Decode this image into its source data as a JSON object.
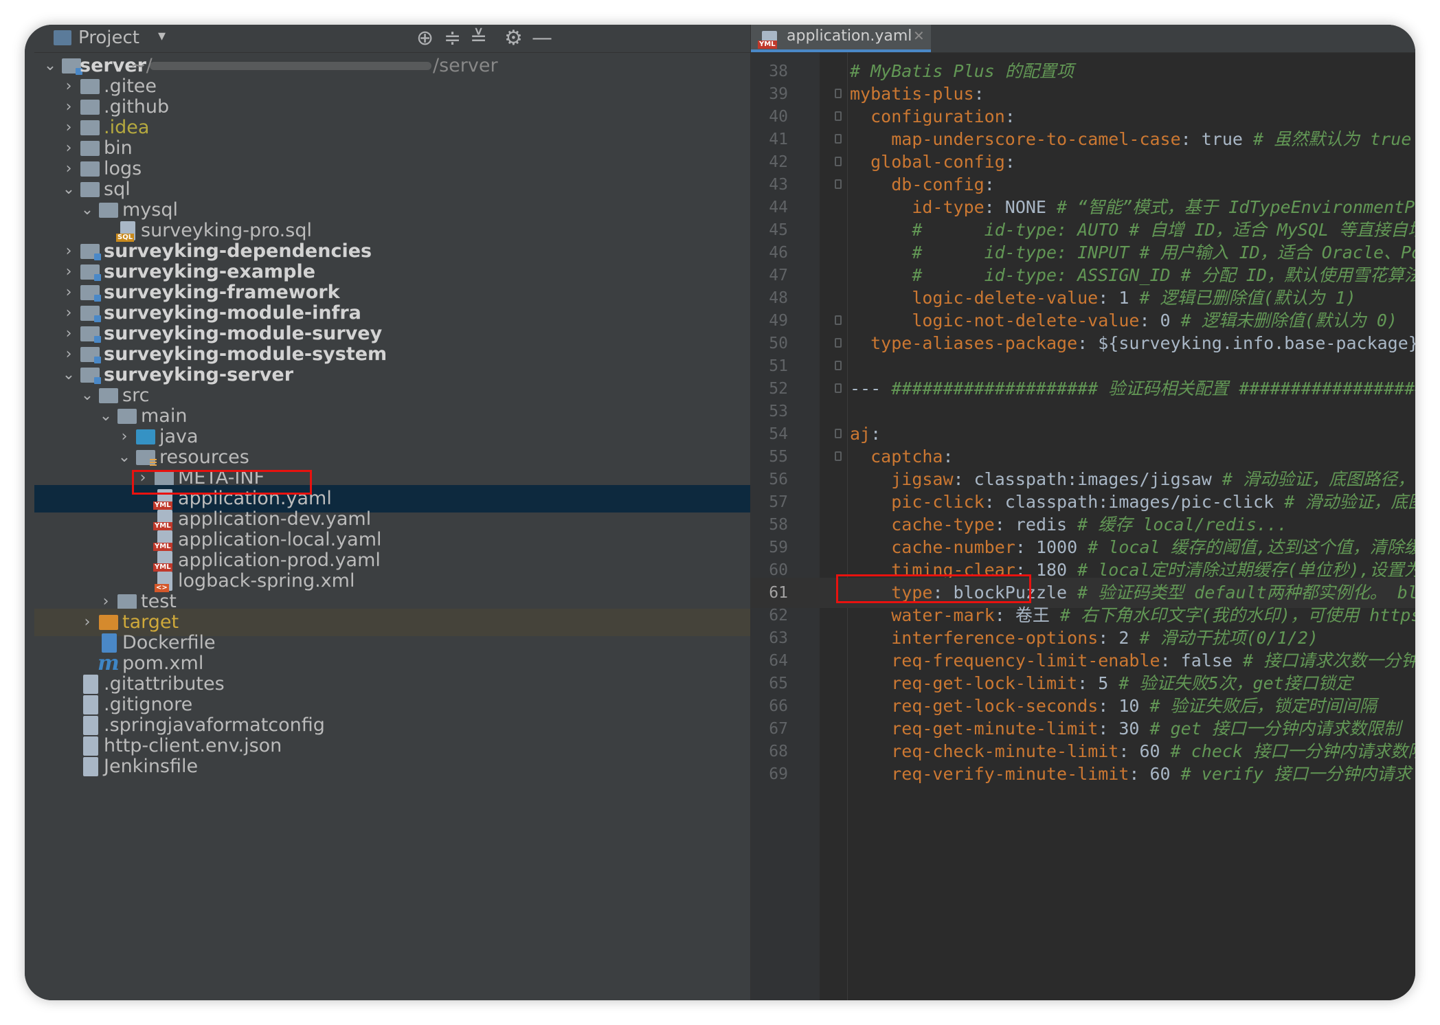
{
  "project_panel": {
    "title": "Project",
    "root": {
      "name": "server",
      "path_prefix": "~/",
      "path_suffix": "/server"
    },
    "tree": [
      {
        "id": "gitee",
        "label": ".gitee",
        "depth": 1,
        "arrow": "›",
        "icon": "folder-icon"
      },
      {
        "id": "github",
        "label": ".github",
        "depth": 1,
        "arrow": "›",
        "icon": "folder-icon"
      },
      {
        "id": "idea",
        "label": ".idea",
        "depth": 1,
        "arrow": "›",
        "icon": "folder-icon"
      },
      {
        "id": "bin",
        "label": "bin",
        "depth": 1,
        "arrow": "›",
        "icon": "folder-icon"
      },
      {
        "id": "logs",
        "label": "logs",
        "depth": 1,
        "arrow": "›",
        "icon": "folder-icon"
      },
      {
        "id": "sql",
        "label": "sql",
        "depth": 1,
        "arrow": "⌄",
        "icon": "folder-icon"
      },
      {
        "id": "mysql",
        "label": "mysql",
        "depth": 2,
        "arrow": "⌄",
        "icon": "folder-icon"
      },
      {
        "id": "sqlfile",
        "label": "surveyking-pro.sql",
        "depth": 3,
        "arrow": "",
        "icon": "sql-file-icon"
      },
      {
        "id": "deps",
        "label": "surveyking-dependencies",
        "depth": 1,
        "arrow": "›",
        "icon": "module-folder-icon"
      },
      {
        "id": "example",
        "label": "surveyking-example",
        "depth": 1,
        "arrow": "›",
        "icon": "module-folder-icon"
      },
      {
        "id": "framework",
        "label": "surveyking-framework",
        "depth": 1,
        "arrow": "›",
        "icon": "module-folder-icon"
      },
      {
        "id": "infra",
        "label": "surveyking-module-infra",
        "depth": 1,
        "arrow": "›",
        "icon": "module-folder-icon"
      },
      {
        "id": "survey",
        "label": "surveyking-module-survey",
        "depth": 1,
        "arrow": "›",
        "icon": "module-folder-icon"
      },
      {
        "id": "system",
        "label": "surveyking-module-system",
        "depth": 1,
        "arrow": "›",
        "icon": "module-folder-icon"
      },
      {
        "id": "serverm",
        "label": "surveyking-server",
        "depth": 1,
        "arrow": "⌄",
        "icon": "module-folder-icon"
      },
      {
        "id": "src",
        "label": "src",
        "depth": 2,
        "arrow": "⌄",
        "icon": "folder-icon"
      },
      {
        "id": "main",
        "label": "main",
        "depth": 3,
        "arrow": "⌄",
        "icon": "folder-icon"
      },
      {
        "id": "java",
        "label": "java",
        "depth": 4,
        "arrow": "›",
        "icon": "source-folder-icon"
      },
      {
        "id": "resources",
        "label": "resources",
        "depth": 4,
        "arrow": "⌄",
        "icon": "resources-folder-icon"
      },
      {
        "id": "metainf",
        "label": "META-INF",
        "depth": 5,
        "arrow": "›",
        "icon": "folder-icon"
      },
      {
        "id": "appyaml",
        "label": "application.yaml",
        "depth": 5,
        "arrow": "",
        "icon": "yaml-file-icon"
      },
      {
        "id": "appdev",
        "label": "application-dev.yaml",
        "depth": 5,
        "arrow": "",
        "icon": "yaml-file-icon"
      },
      {
        "id": "applocal",
        "label": "application-local.yaml",
        "depth": 5,
        "arrow": "",
        "icon": "yaml-file-icon"
      },
      {
        "id": "appprod",
        "label": "application-prod.yaml",
        "depth": 5,
        "arrow": "",
        "icon": "yaml-file-icon"
      },
      {
        "id": "logback",
        "label": "logback-spring.xml",
        "depth": 5,
        "arrow": "",
        "icon": "xml-file-icon"
      },
      {
        "id": "test",
        "label": "test",
        "depth": 3,
        "arrow": "›",
        "icon": "folder-icon"
      },
      {
        "id": "target",
        "label": "target",
        "depth": 2,
        "arrow": "›",
        "icon": "excluded-folder-icon"
      },
      {
        "id": "dockerfile",
        "label": "Dockerfile",
        "depth": 2,
        "arrow": "",
        "icon": "docker-file-icon"
      },
      {
        "id": "pom",
        "label": "pom.xml",
        "depth": 2,
        "arrow": "",
        "icon": "maven-file-icon"
      },
      {
        "id": "gitattr",
        "label": ".gitattributes",
        "depth": 1,
        "arrow": "",
        "icon": "text-file-icon"
      },
      {
        "id": "gitignore",
        "label": ".gitignore",
        "depth": 1,
        "arrow": "",
        "icon": "text-file-icon"
      },
      {
        "id": "springfmt",
        "label": ".springjavaformatconfig",
        "depth": 1,
        "arrow": "",
        "icon": "text-file-icon"
      },
      {
        "id": "httpenv",
        "label": "http-client.env.json",
        "depth": 1,
        "arrow": "",
        "icon": "json-file-icon"
      },
      {
        "id": "jenkins",
        "label": "Jenkinsfile",
        "depth": 1,
        "arrow": "",
        "icon": "text-file-icon"
      }
    ],
    "selected": "application.yaml"
  },
  "editor": {
    "tab_label": "application.yaml",
    "current_line": "61",
    "lines": [
      {
        "n": "38",
        "t": [
          [
            "c",
            "# MyBatis Plus 的配置项"
          ]
        ]
      },
      {
        "n": "39",
        "t": [
          [
            "k",
            "mybatis-plus"
          ],
          [
            "v",
            ":"
          ]
        ]
      },
      {
        "n": "40",
        "t": [
          [
            "v",
            "  "
          ],
          [
            "k",
            "configuration"
          ],
          [
            "v",
            ":"
          ]
        ]
      },
      {
        "n": "41",
        "t": [
          [
            "v",
            "    "
          ],
          [
            "k",
            "map-underscore-to-camel-case"
          ],
          [
            "v",
            ": true "
          ],
          [
            "c",
            "# 虽然默认为 true"
          ]
        ]
      },
      {
        "n": "42",
        "t": [
          [
            "v",
            "  "
          ],
          [
            "k",
            "global-config"
          ],
          [
            "v",
            ":"
          ]
        ]
      },
      {
        "n": "43",
        "t": [
          [
            "v",
            "    "
          ],
          [
            "k",
            "db-config"
          ],
          [
            "v",
            ":"
          ]
        ]
      },
      {
        "n": "44",
        "t": [
          [
            "v",
            "      "
          ],
          [
            "k",
            "id-type"
          ],
          [
            "v",
            ": NONE "
          ],
          [
            "c",
            "# “智能”模式，基于 IdTypeEnvironmentPo"
          ]
        ]
      },
      {
        "n": "45",
        "t": [
          [
            "v",
            "      "
          ],
          [
            "c",
            "#      id-type: AUTO # 自增 ID，适合 MySQL 等直接自增"
          ]
        ]
      },
      {
        "n": "46",
        "t": [
          [
            "v",
            "      "
          ],
          [
            "c",
            "#      id-type: INPUT # 用户输入 ID，适合 Oracle、Po"
          ]
        ]
      },
      {
        "n": "47",
        "t": [
          [
            "v",
            "      "
          ],
          [
            "c",
            "#      id-type: ASSIGN_ID # 分配 ID，默认使用雪花算法"
          ]
        ]
      },
      {
        "n": "48",
        "t": [
          [
            "v",
            "      "
          ],
          [
            "k",
            "logic-delete-value"
          ],
          [
            "v",
            ": 1 "
          ],
          [
            "c",
            "# 逻辑已删除值(默认为 1)"
          ]
        ]
      },
      {
        "n": "49",
        "t": [
          [
            "v",
            "      "
          ],
          [
            "k",
            "logic-not-delete-value"
          ],
          [
            "v",
            ": 0 "
          ],
          [
            "c",
            "# 逻辑未删除值(默认为 0)"
          ]
        ]
      },
      {
        "n": "50",
        "t": [
          [
            "v",
            "  "
          ],
          [
            "k",
            "type-aliases-package"
          ],
          [
            "v",
            ": ${surveyking.info.base-package}"
          ]
        ]
      },
      {
        "n": "51",
        "t": []
      },
      {
        "n": "52",
        "t": [
          [
            "v",
            "--- "
          ],
          [
            "c",
            "#################### 验证码相关配置 ##################"
          ]
        ]
      },
      {
        "n": "53",
        "t": []
      },
      {
        "n": "54",
        "t": [
          [
            "k",
            "aj"
          ],
          [
            "v",
            ":"
          ]
        ]
      },
      {
        "n": "55",
        "t": [
          [
            "v",
            "  "
          ],
          [
            "k",
            "captcha"
          ],
          [
            "v",
            ":"
          ]
        ]
      },
      {
        "n": "56",
        "t": [
          [
            "v",
            "    "
          ],
          [
            "k",
            "jigsaw"
          ],
          [
            "v",
            ": classpath:images/jigsaw "
          ],
          [
            "c",
            "# 滑动验证，底图路径，不"
          ]
        ]
      },
      {
        "n": "57",
        "t": [
          [
            "v",
            "    "
          ],
          [
            "k",
            "pic-click"
          ],
          [
            "v",
            ": classpath:images/pic-click "
          ],
          [
            "c",
            "# 滑动验证，底图"
          ]
        ]
      },
      {
        "n": "58",
        "t": [
          [
            "v",
            "    "
          ],
          [
            "k",
            "cache-type"
          ],
          [
            "v",
            ": redis "
          ],
          [
            "c",
            "# 缓存 local/redis..."
          ]
        ]
      },
      {
        "n": "59",
        "t": [
          [
            "v",
            "    "
          ],
          [
            "k",
            "cache-number"
          ],
          [
            "v",
            ": 1000 "
          ],
          [
            "c",
            "# local 缓存的阈值,达到这个值，清除缓"
          ]
        ]
      },
      {
        "n": "60",
        "t": [
          [
            "v",
            "    "
          ],
          [
            "k",
            "timing-clear"
          ],
          [
            "v",
            ": 180 "
          ],
          [
            "c",
            "# local定时清除过期缓存(单位秒),设置为"
          ]
        ]
      },
      {
        "n": "61",
        "t": [
          [
            "v",
            "    "
          ],
          [
            "k",
            "type"
          ],
          [
            "v",
            ": blockPuzzle "
          ],
          [
            "c",
            "# 验证码类型 default两种都实例化。 bl"
          ]
        ]
      },
      {
        "n": "62",
        "t": [
          [
            "v",
            "    "
          ],
          [
            "k",
            "water-mark"
          ],
          [
            "v",
            ": 卷王 "
          ],
          [
            "c",
            "# 右下角水印文字(我的水印)，可使用 https"
          ]
        ]
      },
      {
        "n": "63",
        "t": [
          [
            "v",
            "    "
          ],
          [
            "k",
            "interference-options"
          ],
          [
            "v",
            ": 2 "
          ],
          [
            "c",
            "# 滑动干扰项(0/1/2)"
          ]
        ]
      },
      {
        "n": "64",
        "t": [
          [
            "v",
            "    "
          ],
          [
            "k",
            "req-frequency-limit-enable"
          ],
          [
            "v",
            ": false "
          ],
          [
            "c",
            "# 接口请求次数一分钟"
          ]
        ]
      },
      {
        "n": "65",
        "t": [
          [
            "v",
            "    "
          ],
          [
            "k",
            "req-get-lock-limit"
          ],
          [
            "v",
            ": 5 "
          ],
          [
            "c",
            "# 验证失败5次，get接口锁定"
          ]
        ]
      },
      {
        "n": "66",
        "t": [
          [
            "v",
            "    "
          ],
          [
            "k",
            "req-get-lock-seconds"
          ],
          [
            "v",
            ": 10 "
          ],
          [
            "c",
            "# 验证失败后，锁定时间间隔"
          ]
        ]
      },
      {
        "n": "67",
        "t": [
          [
            "v",
            "    "
          ],
          [
            "k",
            "req-get-minute-limit"
          ],
          [
            "v",
            ": 30 "
          ],
          [
            "c",
            "# get 接口一分钟内请求数限制"
          ]
        ]
      },
      {
        "n": "68",
        "t": [
          [
            "v",
            "    "
          ],
          [
            "k",
            "req-check-minute-limit"
          ],
          [
            "v",
            ": 60 "
          ],
          [
            "c",
            "# check 接口一分钟内请求数限"
          ]
        ]
      },
      {
        "n": "69",
        "t": [
          [
            "v",
            "    "
          ],
          [
            "k",
            "req-verify-minute-limit"
          ],
          [
            "v",
            ": 60 "
          ],
          [
            "c",
            "# verify 接口一分钟内请求"
          ]
        ]
      }
    ]
  },
  "colors": {
    "selection": "#0d293e",
    "highlight_box": "#e8120f",
    "yaml_key": "#cc7832",
    "comment": "#629755",
    "plain": "#a9b7c6"
  }
}
